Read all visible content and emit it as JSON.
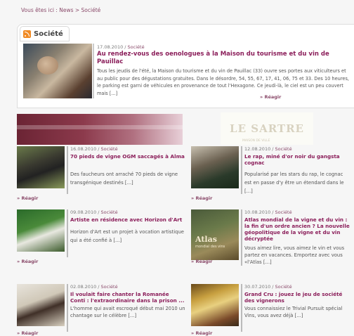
{
  "breadcrumb": "Vous êtes ici : News > Société",
  "section": {
    "title": "Société",
    "icon": "rss-icon"
  },
  "featured": {
    "date": "17.08.2010",
    "category": "Société",
    "title": "Au rendez-vous des oenologues à la Maison du tourisme et du vin de Pauillac",
    "text": "Tous les jeudis de l'été, la Maison du tourisme et du vin de Pauillac (33) ouvre ses portes aux viticulteurs et au public pour des dégustations gratuites. Dans le désordre, 54, 55, 67, 17, 41, 06, 75 et 33. Des 10 heures, le parking est garni de véhicules en provenance de tout l'Hexagone. Ce jeudi-là, le ciel est un peu couvert mais [...]",
    "more": "» Réagir"
  },
  "sidebar_logo": {
    "text": "LE SARTRE",
    "tagline": "MAISON DE VILLE"
  },
  "articles": [
    {
      "date": "16.08.2010",
      "category": "Société",
      "title": "70 pieds de vigne OGM saccagés à Alma",
      "text": "Des faucheurs ont arraché 70 pieds de vigne transgénique destinés [...]",
      "more": "» Réagir"
    },
    {
      "date": "12.08.2010",
      "category": "Société",
      "title": "Le rap, miné d'or noir du gangsta cognac",
      "text": "Popularisé par les stars du rap, le cognac est en passe d'y être un étendard dans le [...]",
      "more": "» Réagir"
    },
    {
      "date": "09.08.2010",
      "category": "Société",
      "title": "Artiste en résidence avec Horizon d'Art",
      "text": "Horizon d'Art est un projet à vocation artistique qui a été confié à [...]",
      "more": "» Réagir"
    },
    {
      "date": "10.08.2010",
      "category": "Société",
      "title": "Atlas mondial de la vigne et du vin : la fin d'un ordre ancien ? La nouvelle géopolitique de la vigne et du vin décryptée",
      "text": "Vous aimez lire, vous aimez le vin et vous partez en vacances. Emportez avec vous «l'Atlas [...]",
      "more": "» Réagir",
      "image_label": "Atlas",
      "image_sub": "mondial des vins"
    },
    {
      "date": "02.08.2010",
      "category": "Société",
      "title": "Il voulait faire chanter la Romanée Conti : l'extraordinaire dans la prison ...",
      "text": "L'homme qui avait escroqué début mai 2010 un chantage sur le célèbre [...]",
      "more": "» Réagir"
    },
    {
      "date": "30.07.2010",
      "category": "Société",
      "title": "Grand Cru : jouez le jeu de société des vignerons",
      "text": "Vous connaissiez le Trivial Pursuit spécial Vins, vous avez déjà [...]",
      "more": "» Réagir"
    }
  ]
}
